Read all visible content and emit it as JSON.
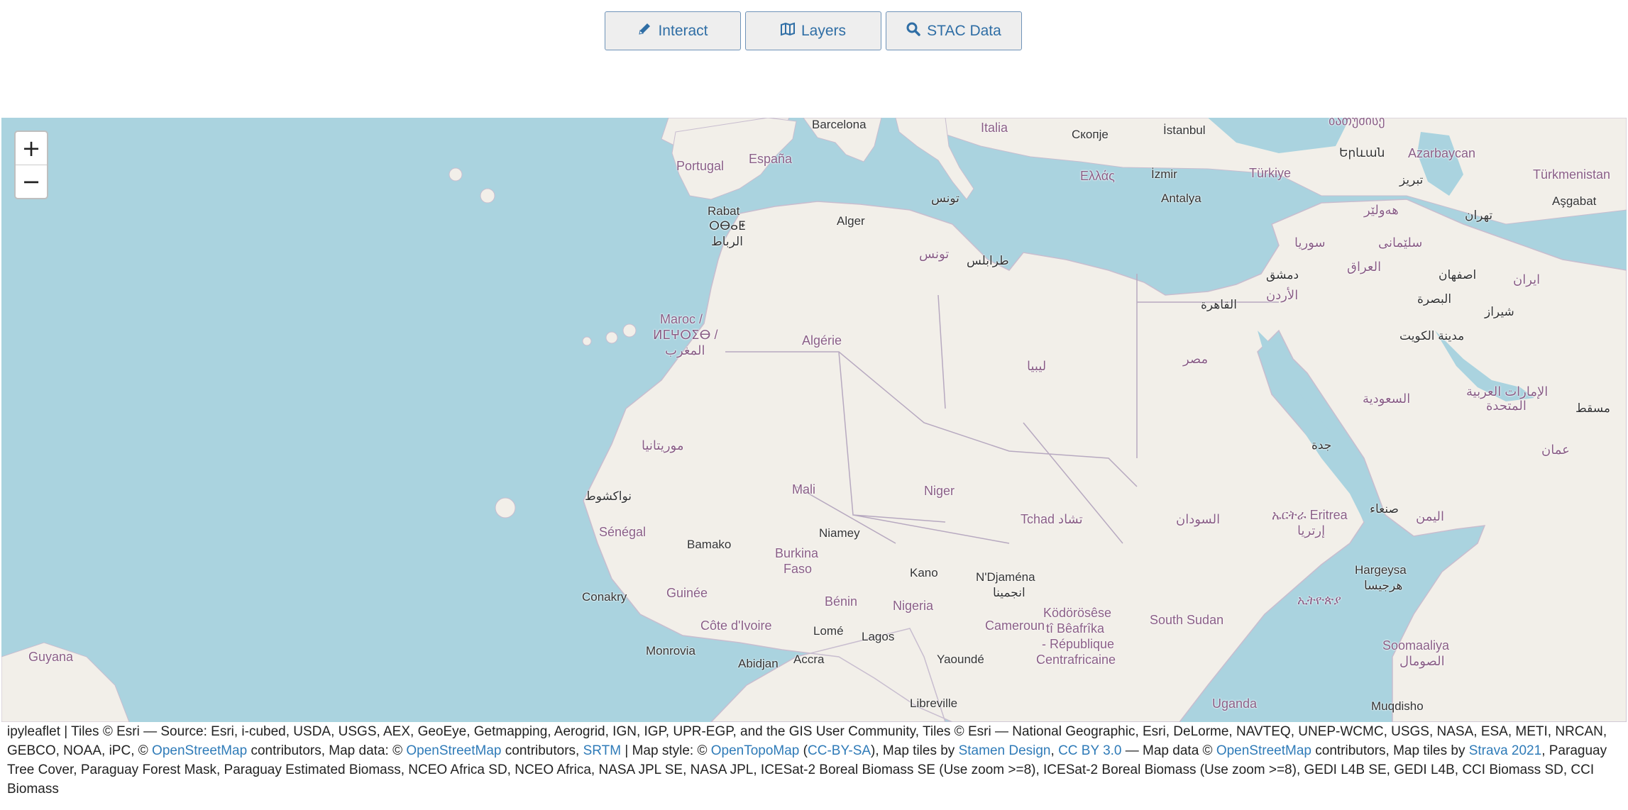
{
  "toolbar": {
    "buttons": [
      {
        "label": "Interact",
        "icon": "pencil-icon"
      },
      {
        "label": "Layers",
        "icon": "map-icon"
      },
      {
        "label": "STAC Data",
        "icon": "search-icon"
      }
    ]
  },
  "map": {
    "zoom_in": "+",
    "zoom_out": "−",
    "labels": {
      "barcelona": "Barcelona",
      "italia": "Italia",
      "skopje": "Скопје",
      "istanbul": "İstanbul",
      "tbilisi": "ბათუმისე",
      "portugal": "Portugal",
      "espana": "España",
      "yerevan": "Երևան",
      "azarbaycan": "Azarbaycan",
      "ellas": "Ελλάς",
      "izmir": "İzmir",
      "turkiye": "Türkiye",
      "tabriz": "تبریز",
      "turkmenistan": "Türkmenistan",
      "asgabat": "Aşgabat",
      "tunis_ar": "تونس",
      "antalya": "Antalya",
      "rabat": "Rabat",
      "rabat_tf": "ⵔⴱⴰⵟ",
      "rabat_ar": "الرباط",
      "alger": "Alger",
      "erbil": "هەولێر",
      "tehran": "تهران",
      "suriya": "سوريا",
      "sulaymaniyah": "سلێمانی",
      "tunisia_ar": "تونس",
      "tripoli": "طرابلس",
      "damascus": "دمشق",
      "iraq": "العراق",
      "isfahan": "اصفهان",
      "iran": "ایران",
      "jordan": "الأردن",
      "cairo": "القاهرة",
      "basra": "البصرة",
      "shiraz": "شیراز",
      "maroc": "Maroc /",
      "maroc_tf": "ⵍⵎⵖⵔⵉⴱ /",
      "maroc_ar": "المغرب",
      "algerie": "Algérie",
      "kuwait": "مدينة الكويت",
      "misr": "مصر",
      "libya": "ليبيا",
      "uae": "الإمارات العربية",
      "uae2": "المتحدة",
      "saudi": "السعودية",
      "muscat": "مسقط",
      "mauritania": "موريتانيا",
      "jeddah": "جدة",
      "oman": "عمان",
      "mali": "Mali",
      "niger": "Niger",
      "nouakchott": "نواكشوط",
      "tchad": "Tchad تشاد",
      "sudan": "السودان",
      "eritrea": "ኤርትራ Eritrea",
      "eritrea_ar": "إرتريا",
      "sanaa": "صنعاء",
      "yemen": "اليمن",
      "senegal": "Sénégal",
      "bamako": "Bamako",
      "niamey": "Niamey",
      "burkina": "Burkina",
      "faso": "Faso",
      "kano": "Kano",
      "ndjamena": "N'Djaména",
      "ndjamena_ar": "انجمينا",
      "hargeysa": "Hargeysa",
      "hargeysa_ar": "هرجيسا",
      "ethiopia": "ኢትዮጵያ",
      "conakry": "Conakry",
      "guinee": "Guinée",
      "benin": "Bénin",
      "nigeria": "Nigeria",
      "kodorosese": "Ködörösêse",
      "beafrika": "tî Bêafrîka",
      "republique": "- République",
      "centrafricaine": "Centrafricaine",
      "south_sudan": "South Sudan",
      "cote": "Côte d'Ivoire",
      "lome": "Lomé",
      "lagos": "Lagos",
      "cameroun": "Cameroun",
      "somaaliya": "Soomaaliya",
      "somalia_ar": "الصومال",
      "guyana": "Guyana",
      "monrovia": "Monrovia",
      "abidjan": "Abidjan",
      "accra": "Accra",
      "yaounde": "Yaoundé",
      "libreville": "Libreville",
      "uganda": "Uganda",
      "muqdisho": "Muqdisho"
    }
  },
  "attribution": {
    "t1": "ipyleaflet | Tiles © Esri — Source: Esri, i-cubed, USDA, USGS, AEX, GeoEye, Getmapping, Aerogrid, IGN, IGP, UPR-EGP, and the GIS User Community, Tiles © Esri — National Geographic, Esri, DeLorme, NAVTEQ, UNEP-WCMC, USGS, NASA, ESA, METI, NRCAN, GEBCO, NOAA, iPC, © ",
    "l1": "OpenStreetMap",
    "t2": " contributors, Map data: © ",
    "l2": "OpenStreetMap",
    "t3": " contributors, ",
    "l3": "SRTM",
    "t4": " | Map style: © ",
    "l4": "OpenTopoMap",
    "t5": " (",
    "l5": "CC-BY-SA",
    "t6": "), Map tiles by ",
    "l6": "Stamen Design",
    "t7": ", ",
    "l7": "CC BY 3.0",
    "t8": " — Map data © ",
    "l8": "OpenStreetMap",
    "t9": " contributors, Map tiles by ",
    "l9": "Strava 2021",
    "t10": ", Paraguay Tree Cover, Paraguay Forest Mask, Paraguay Estimated Biomass, NCEO Africa SD, NCEO Africa, NASA JPL SE, NASA JPL, ICESat-2 Boreal Biomass SE (Use zoom >=8), ICESat-2 Boreal Biomass (Use zoom >=8), GEDI L4B SE, GEDI L4B, CCI Biomass SD, CCI Biomass"
  }
}
